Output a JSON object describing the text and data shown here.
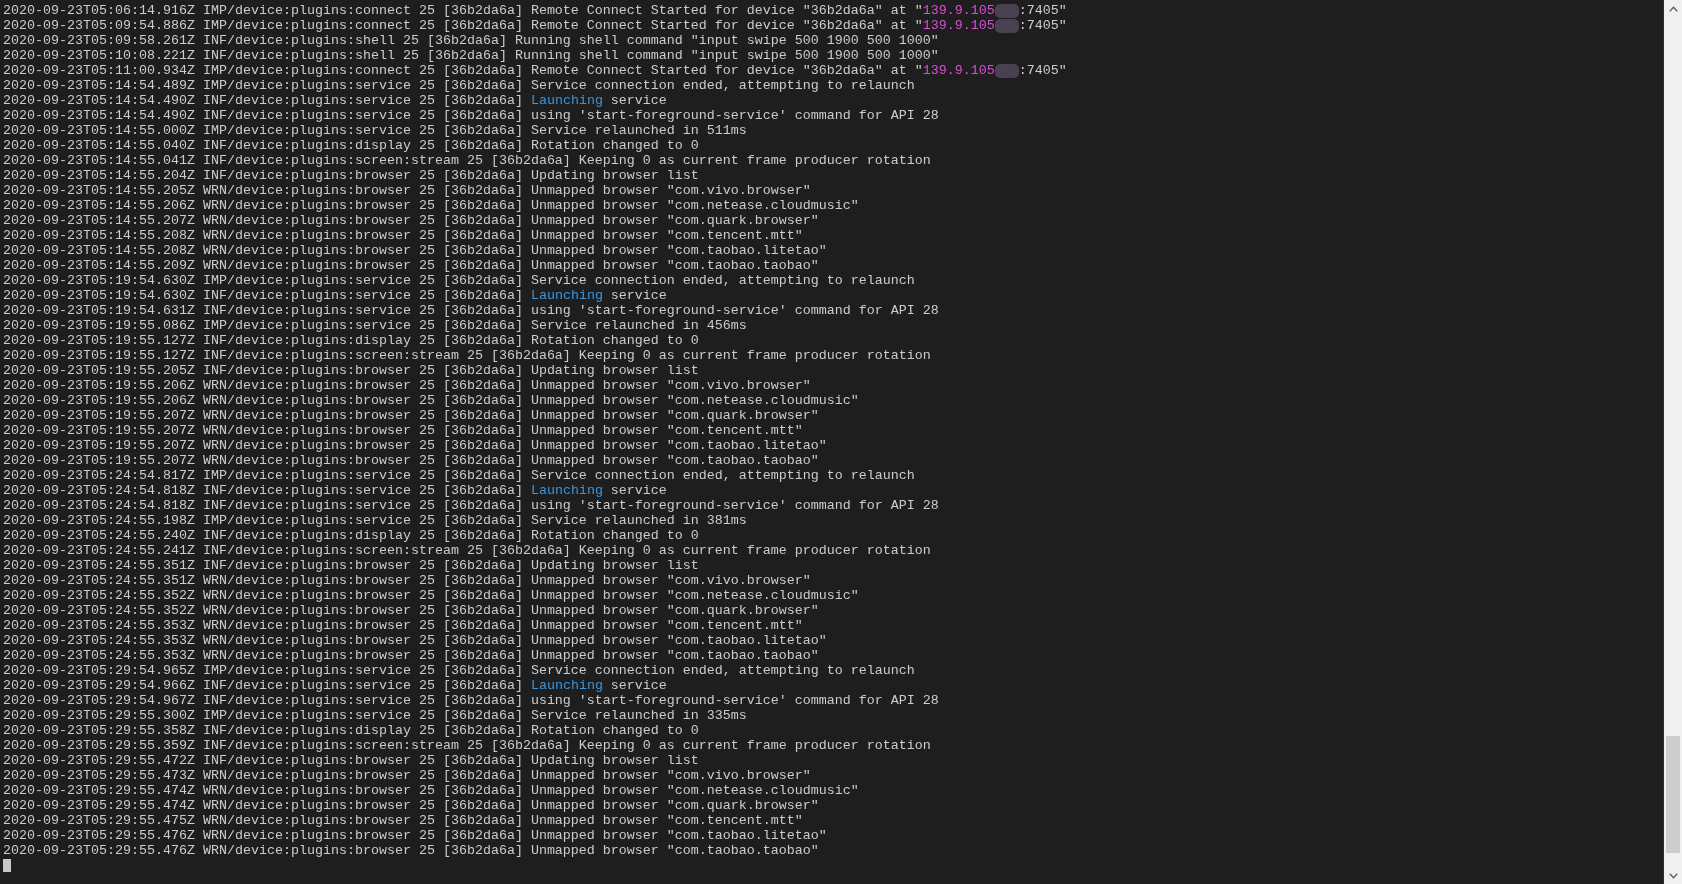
{
  "terminal": {
    "lines": [
      [
        {
          "kind": "plain",
          "text": "2020-09-23T05:06:14.916Z IMP/device:plugins:connect 25 [36b2da6a] Remote Connect Started for device \"36b2da6a\" at \""
        },
        {
          "kind": "address",
          "text": "139.9.105"
        },
        {
          "kind": "redacted"
        },
        {
          "kind": "plain",
          "text": ":7405\""
        }
      ],
      [
        {
          "kind": "plain",
          "text": "2020-09-23T05:09:54.886Z IMP/device:plugins:connect 25 [36b2da6a] Remote Connect Started for device \"36b2da6a\" at \""
        },
        {
          "kind": "address",
          "text": "139.9.105"
        },
        {
          "kind": "redacted"
        },
        {
          "kind": "plain",
          "text": ":7405\""
        }
      ],
      [
        {
          "kind": "plain",
          "text": "2020-09-23T05:09:58.261Z INF/device:plugins:shell 25 [36b2da6a] Running shell command \"input swipe 500 1900 500 1000\""
        }
      ],
      [
        {
          "kind": "plain",
          "text": "2020-09-23T05:10:08.221Z INF/device:plugins:shell 25 [36b2da6a] Running shell command \"input swipe 500 1900 500 1000\""
        }
      ],
      [
        {
          "kind": "plain",
          "text": "2020-09-23T05:11:00.934Z IMP/device:plugins:connect 25 [36b2da6a] Remote Connect Started for device \"36b2da6a\" at \""
        },
        {
          "kind": "address",
          "text": "139.9.105"
        },
        {
          "kind": "redacted"
        },
        {
          "kind": "plain",
          "text": ":7405\""
        }
      ],
      [
        {
          "kind": "plain",
          "text": "2020-09-23T05:14:54.489Z IMP/device:plugins:service 25 [36b2da6a] Service connection ended, attempting to relaunch"
        }
      ],
      [
        {
          "kind": "plain",
          "text": "2020-09-23T05:14:54.490Z INF/device:plugins:service 25 [36b2da6a] "
        },
        {
          "kind": "keyword",
          "text": "Launching"
        },
        {
          "kind": "plain",
          "text": " service"
        }
      ],
      [
        {
          "kind": "plain",
          "text": "2020-09-23T05:14:54.490Z INF/device:plugins:service 25 [36b2da6a] using 'start-foreground-service' command for API 28"
        }
      ],
      [
        {
          "kind": "plain",
          "text": "2020-09-23T05:14:55.000Z IMP/device:plugins:service 25 [36b2da6a] Service relaunched in 511ms"
        }
      ],
      [
        {
          "kind": "plain",
          "text": "2020-09-23T05:14:55.040Z INF/device:plugins:display 25 [36b2da6a] Rotation changed to 0"
        }
      ],
      [
        {
          "kind": "plain",
          "text": "2020-09-23T05:14:55.041Z INF/device:plugins:screen:stream 25 [36b2da6a] Keeping 0 as current frame producer rotation"
        }
      ],
      [
        {
          "kind": "plain",
          "text": "2020-09-23T05:14:55.204Z INF/device:plugins:browser 25 [36b2da6a] Updating browser list"
        }
      ],
      [
        {
          "kind": "plain",
          "text": "2020-09-23T05:14:55.205Z WRN/device:plugins:browser 25 [36b2da6a] Unmapped browser \"com.vivo.browser\""
        }
      ],
      [
        {
          "kind": "plain",
          "text": "2020-09-23T05:14:55.206Z WRN/device:plugins:browser 25 [36b2da6a] Unmapped browser \"com.netease.cloudmusic\""
        }
      ],
      [
        {
          "kind": "plain",
          "text": "2020-09-23T05:14:55.207Z WRN/device:plugins:browser 25 [36b2da6a] Unmapped browser \"com.quark.browser\""
        }
      ],
      [
        {
          "kind": "plain",
          "text": "2020-09-23T05:14:55.208Z WRN/device:plugins:browser 25 [36b2da6a] Unmapped browser \"com.tencent.mtt\""
        }
      ],
      [
        {
          "kind": "plain",
          "text": "2020-09-23T05:14:55.208Z WRN/device:plugins:browser 25 [36b2da6a] Unmapped browser \"com.taobao.litetao\""
        }
      ],
      [
        {
          "kind": "plain",
          "text": "2020-09-23T05:14:55.209Z WRN/device:plugins:browser 25 [36b2da6a] Unmapped browser \"com.taobao.taobao\""
        }
      ],
      [
        {
          "kind": "plain",
          "text": "2020-09-23T05:19:54.630Z IMP/device:plugins:service 25 [36b2da6a] Service connection ended, attempting to relaunch"
        }
      ],
      [
        {
          "kind": "plain",
          "text": "2020-09-23T05:19:54.630Z INF/device:plugins:service 25 [36b2da6a] "
        },
        {
          "kind": "keyword",
          "text": "Launching"
        },
        {
          "kind": "plain",
          "text": " service"
        }
      ],
      [
        {
          "kind": "plain",
          "text": "2020-09-23T05:19:54.631Z INF/device:plugins:service 25 [36b2da6a] using 'start-foreground-service' command for API 28"
        }
      ],
      [
        {
          "kind": "plain",
          "text": "2020-09-23T05:19:55.086Z IMP/device:plugins:service 25 [36b2da6a] Service relaunched in 456ms"
        }
      ],
      [
        {
          "kind": "plain",
          "text": "2020-09-23T05:19:55.127Z INF/device:plugins:display 25 [36b2da6a] Rotation changed to 0"
        }
      ],
      [
        {
          "kind": "plain",
          "text": "2020-09-23T05:19:55.127Z INF/device:plugins:screen:stream 25 [36b2da6a] Keeping 0 as current frame producer rotation"
        }
      ],
      [
        {
          "kind": "plain",
          "text": "2020-09-23T05:19:55.205Z INF/device:plugins:browser 25 [36b2da6a] Updating browser list"
        }
      ],
      [
        {
          "kind": "plain",
          "text": "2020-09-23T05:19:55.206Z WRN/device:plugins:browser 25 [36b2da6a] Unmapped browser \"com.vivo.browser\""
        }
      ],
      [
        {
          "kind": "plain",
          "text": "2020-09-23T05:19:55.206Z WRN/device:plugins:browser 25 [36b2da6a] Unmapped browser \"com.netease.cloudmusic\""
        }
      ],
      [
        {
          "kind": "plain",
          "text": "2020-09-23T05:19:55.207Z WRN/device:plugins:browser 25 [36b2da6a] Unmapped browser \"com.quark.browser\""
        }
      ],
      [
        {
          "kind": "plain",
          "text": "2020-09-23T05:19:55.207Z WRN/device:plugins:browser 25 [36b2da6a] Unmapped browser \"com.tencent.mtt\""
        }
      ],
      [
        {
          "kind": "plain",
          "text": "2020-09-23T05:19:55.207Z WRN/device:plugins:browser 25 [36b2da6a] Unmapped browser \"com.taobao.litetao\""
        }
      ],
      [
        {
          "kind": "plain",
          "text": "2020-09-23T05:19:55.207Z WRN/device:plugins:browser 25 [36b2da6a] Unmapped browser \"com.taobao.taobao\""
        }
      ],
      [
        {
          "kind": "plain",
          "text": "2020-09-23T05:24:54.817Z IMP/device:plugins:service 25 [36b2da6a] Service connection ended, attempting to relaunch"
        }
      ],
      [
        {
          "kind": "plain",
          "text": "2020-09-23T05:24:54.818Z INF/device:plugins:service 25 [36b2da6a] "
        },
        {
          "kind": "keyword",
          "text": "Launching"
        },
        {
          "kind": "plain",
          "text": " service"
        }
      ],
      [
        {
          "kind": "plain",
          "text": "2020-09-23T05:24:54.818Z INF/device:plugins:service 25 [36b2da6a] using 'start-foreground-service' command for API 28"
        }
      ],
      [
        {
          "kind": "plain",
          "text": "2020-09-23T05:24:55.198Z IMP/device:plugins:service 25 [36b2da6a] Service relaunched in 381ms"
        }
      ],
      [
        {
          "kind": "plain",
          "text": "2020-09-23T05:24:55.240Z INF/device:plugins:display 25 [36b2da6a] Rotation changed to 0"
        }
      ],
      [
        {
          "kind": "plain",
          "text": "2020-09-23T05:24:55.241Z INF/device:plugins:screen:stream 25 [36b2da6a] Keeping 0 as current frame producer rotation"
        }
      ],
      [
        {
          "kind": "plain",
          "text": "2020-09-23T05:24:55.351Z INF/device:plugins:browser 25 [36b2da6a] Updating browser list"
        }
      ],
      [
        {
          "kind": "plain",
          "text": "2020-09-23T05:24:55.351Z WRN/device:plugins:browser 25 [36b2da6a] Unmapped browser \"com.vivo.browser\""
        }
      ],
      [
        {
          "kind": "plain",
          "text": "2020-09-23T05:24:55.352Z WRN/device:plugins:browser 25 [36b2da6a] Unmapped browser \"com.netease.cloudmusic\""
        }
      ],
      [
        {
          "kind": "plain",
          "text": "2020-09-23T05:24:55.352Z WRN/device:plugins:browser 25 [36b2da6a] Unmapped browser \"com.quark.browser\""
        }
      ],
      [
        {
          "kind": "plain",
          "text": "2020-09-23T05:24:55.353Z WRN/device:plugins:browser 25 [36b2da6a] Unmapped browser \"com.tencent.mtt\""
        }
      ],
      [
        {
          "kind": "plain",
          "text": "2020-09-23T05:24:55.353Z WRN/device:plugins:browser 25 [36b2da6a] Unmapped browser \"com.taobao.litetao\""
        }
      ],
      [
        {
          "kind": "plain",
          "text": "2020-09-23T05:24:55.353Z WRN/device:plugins:browser 25 [36b2da6a] Unmapped browser \"com.taobao.taobao\""
        }
      ],
      [
        {
          "kind": "plain",
          "text": "2020-09-23T05:29:54.965Z IMP/device:plugins:service 25 [36b2da6a] Service connection ended, attempting to relaunch"
        }
      ],
      [
        {
          "kind": "plain",
          "text": "2020-09-23T05:29:54.966Z INF/device:plugins:service 25 [36b2da6a] "
        },
        {
          "kind": "keyword",
          "text": "Launching"
        },
        {
          "kind": "plain",
          "text": " service"
        }
      ],
      [
        {
          "kind": "plain",
          "text": "2020-09-23T05:29:54.967Z INF/device:plugins:service 25 [36b2da6a] using 'start-foreground-service' command for API 28"
        }
      ],
      [
        {
          "kind": "plain",
          "text": "2020-09-23T05:29:55.300Z IMP/device:plugins:service 25 [36b2da6a] Service relaunched in 335ms"
        }
      ],
      [
        {
          "kind": "plain",
          "text": "2020-09-23T05:29:55.358Z INF/device:plugins:display 25 [36b2da6a] Rotation changed to 0"
        }
      ],
      [
        {
          "kind": "plain",
          "text": "2020-09-23T05:29:55.359Z INF/device:plugins:screen:stream 25 [36b2da6a] Keeping 0 as current frame producer rotation"
        }
      ],
      [
        {
          "kind": "plain",
          "text": "2020-09-23T05:29:55.472Z INF/device:plugins:browser 25 [36b2da6a] Updating browser list"
        }
      ],
      [
        {
          "kind": "plain",
          "text": "2020-09-23T05:29:55.473Z WRN/device:plugins:browser 25 [36b2da6a] Unmapped browser \"com.vivo.browser\""
        }
      ],
      [
        {
          "kind": "plain",
          "text": "2020-09-23T05:29:55.474Z WRN/device:plugins:browser 25 [36b2da6a] Unmapped browser \"com.netease.cloudmusic\""
        }
      ],
      [
        {
          "kind": "plain",
          "text": "2020-09-23T05:29:55.474Z WRN/device:plugins:browser 25 [36b2da6a] Unmapped browser \"com.quark.browser\""
        }
      ],
      [
        {
          "kind": "plain",
          "text": "2020-09-23T05:29:55.475Z WRN/device:plugins:browser 25 [36b2da6a] Unmapped browser \"com.tencent.mtt\""
        }
      ],
      [
        {
          "kind": "plain",
          "text": "2020-09-23T05:29:55.476Z WRN/device:plugins:browser 25 [36b2da6a] Unmapped browser \"com.taobao.litetao\""
        }
      ],
      [
        {
          "kind": "plain",
          "text": "2020-09-23T05:29:55.476Z WRN/device:plugins:browser 25 [36b2da6a] Unmapped browser \"com.taobao.taobao\""
        }
      ]
    ],
    "cursor": {
      "shown": true
    }
  }
}
